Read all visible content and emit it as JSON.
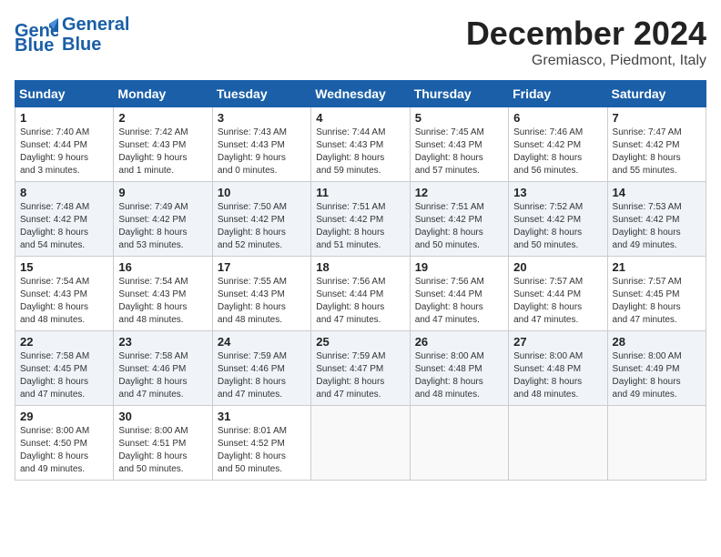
{
  "header": {
    "logo_text_general": "General",
    "logo_text_blue": "Blue",
    "title": "December 2024",
    "subtitle": "Gremiasco, Piedmont, Italy"
  },
  "calendar": {
    "weekdays": [
      "Sunday",
      "Monday",
      "Tuesday",
      "Wednesday",
      "Thursday",
      "Friday",
      "Saturday"
    ],
    "weeks": [
      [
        {
          "day": "1",
          "info": "Sunrise: 7:40 AM\nSunset: 4:44 PM\nDaylight: 9 hours\nand 3 minutes."
        },
        {
          "day": "2",
          "info": "Sunrise: 7:42 AM\nSunset: 4:43 PM\nDaylight: 9 hours\nand 1 minute."
        },
        {
          "day": "3",
          "info": "Sunrise: 7:43 AM\nSunset: 4:43 PM\nDaylight: 9 hours\nand 0 minutes."
        },
        {
          "day": "4",
          "info": "Sunrise: 7:44 AM\nSunset: 4:43 PM\nDaylight: 8 hours\nand 59 minutes."
        },
        {
          "day": "5",
          "info": "Sunrise: 7:45 AM\nSunset: 4:43 PM\nDaylight: 8 hours\nand 57 minutes."
        },
        {
          "day": "6",
          "info": "Sunrise: 7:46 AM\nSunset: 4:42 PM\nDaylight: 8 hours\nand 56 minutes."
        },
        {
          "day": "7",
          "info": "Sunrise: 7:47 AM\nSunset: 4:42 PM\nDaylight: 8 hours\nand 55 minutes."
        }
      ],
      [
        {
          "day": "8",
          "info": "Sunrise: 7:48 AM\nSunset: 4:42 PM\nDaylight: 8 hours\nand 54 minutes."
        },
        {
          "day": "9",
          "info": "Sunrise: 7:49 AM\nSunset: 4:42 PM\nDaylight: 8 hours\nand 53 minutes."
        },
        {
          "day": "10",
          "info": "Sunrise: 7:50 AM\nSunset: 4:42 PM\nDaylight: 8 hours\nand 52 minutes."
        },
        {
          "day": "11",
          "info": "Sunrise: 7:51 AM\nSunset: 4:42 PM\nDaylight: 8 hours\nand 51 minutes."
        },
        {
          "day": "12",
          "info": "Sunrise: 7:51 AM\nSunset: 4:42 PM\nDaylight: 8 hours\nand 50 minutes."
        },
        {
          "day": "13",
          "info": "Sunrise: 7:52 AM\nSunset: 4:42 PM\nDaylight: 8 hours\nand 50 minutes."
        },
        {
          "day": "14",
          "info": "Sunrise: 7:53 AM\nSunset: 4:42 PM\nDaylight: 8 hours\nand 49 minutes."
        }
      ],
      [
        {
          "day": "15",
          "info": "Sunrise: 7:54 AM\nSunset: 4:43 PM\nDaylight: 8 hours\nand 48 minutes."
        },
        {
          "day": "16",
          "info": "Sunrise: 7:54 AM\nSunset: 4:43 PM\nDaylight: 8 hours\nand 48 minutes."
        },
        {
          "day": "17",
          "info": "Sunrise: 7:55 AM\nSunset: 4:43 PM\nDaylight: 8 hours\nand 48 minutes."
        },
        {
          "day": "18",
          "info": "Sunrise: 7:56 AM\nSunset: 4:44 PM\nDaylight: 8 hours\nand 47 minutes."
        },
        {
          "day": "19",
          "info": "Sunrise: 7:56 AM\nSunset: 4:44 PM\nDaylight: 8 hours\nand 47 minutes."
        },
        {
          "day": "20",
          "info": "Sunrise: 7:57 AM\nSunset: 4:44 PM\nDaylight: 8 hours\nand 47 minutes."
        },
        {
          "day": "21",
          "info": "Sunrise: 7:57 AM\nSunset: 4:45 PM\nDaylight: 8 hours\nand 47 minutes."
        }
      ],
      [
        {
          "day": "22",
          "info": "Sunrise: 7:58 AM\nSunset: 4:45 PM\nDaylight: 8 hours\nand 47 minutes."
        },
        {
          "day": "23",
          "info": "Sunrise: 7:58 AM\nSunset: 4:46 PM\nDaylight: 8 hours\nand 47 minutes."
        },
        {
          "day": "24",
          "info": "Sunrise: 7:59 AM\nSunset: 4:46 PM\nDaylight: 8 hours\nand 47 minutes."
        },
        {
          "day": "25",
          "info": "Sunrise: 7:59 AM\nSunset: 4:47 PM\nDaylight: 8 hours\nand 47 minutes."
        },
        {
          "day": "26",
          "info": "Sunrise: 8:00 AM\nSunset: 4:48 PM\nDaylight: 8 hours\nand 48 minutes."
        },
        {
          "day": "27",
          "info": "Sunrise: 8:00 AM\nSunset: 4:48 PM\nDaylight: 8 hours\nand 48 minutes."
        },
        {
          "day": "28",
          "info": "Sunrise: 8:00 AM\nSunset: 4:49 PM\nDaylight: 8 hours\nand 49 minutes."
        }
      ],
      [
        {
          "day": "29",
          "info": "Sunrise: 8:00 AM\nSunset: 4:50 PM\nDaylight: 8 hours\nand 49 minutes."
        },
        {
          "day": "30",
          "info": "Sunrise: 8:00 AM\nSunset: 4:51 PM\nDaylight: 8 hours\nand 50 minutes."
        },
        {
          "day": "31",
          "info": "Sunrise: 8:01 AM\nSunset: 4:52 PM\nDaylight: 8 hours\nand 50 minutes."
        },
        {
          "day": "",
          "info": ""
        },
        {
          "day": "",
          "info": ""
        },
        {
          "day": "",
          "info": ""
        },
        {
          "day": "",
          "info": ""
        }
      ]
    ]
  }
}
